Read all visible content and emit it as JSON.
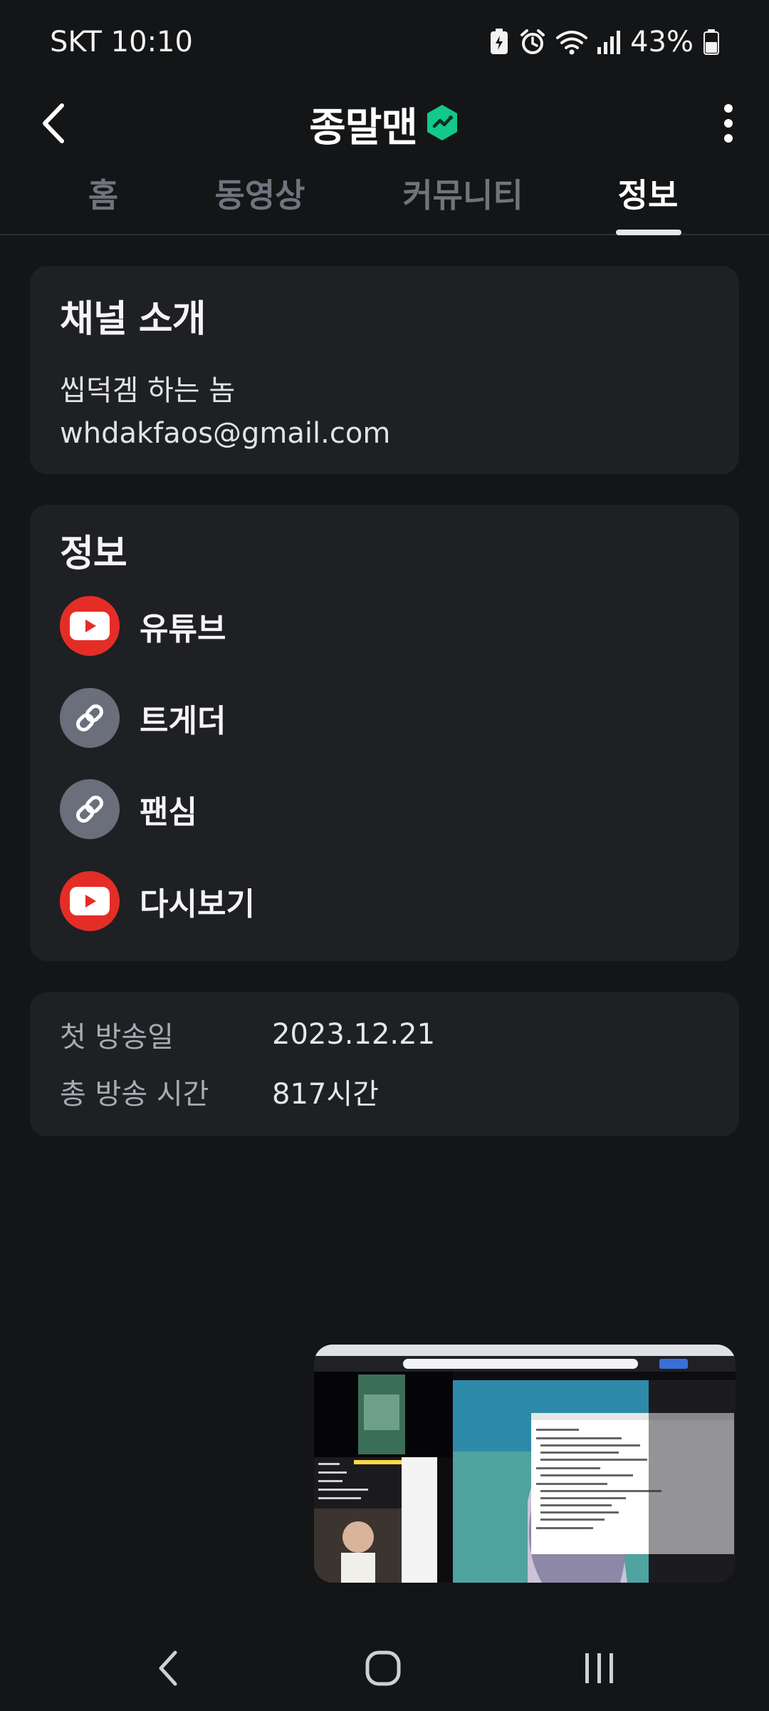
{
  "status_bar": {
    "time": "SKT 10:10",
    "battery": "43%"
  },
  "header": {
    "channel_name": "종말맨"
  },
  "tabs": [
    {
      "label": "홈",
      "active": false
    },
    {
      "label": "동영상",
      "active": false
    },
    {
      "label": "커뮤니티",
      "active": false
    },
    {
      "label": "정보",
      "active": true
    }
  ],
  "intro": {
    "title": "채널 소개",
    "lines": [
      "씹덕겜 하는 놈",
      "whdakfaos@gmail.com"
    ]
  },
  "info": {
    "title": "정보",
    "links": [
      {
        "label": "유튜브",
        "icon": "youtube-icon"
      },
      {
        "label": "트게더",
        "icon": "link-icon"
      },
      {
        "label": "팬심",
        "icon": "link-icon"
      },
      {
        "label": "다시보기",
        "icon": "youtube-icon"
      }
    ]
  },
  "stats": [
    {
      "label": "첫 방송일",
      "value": "2023.12.21"
    },
    {
      "label": "총 방송 시간",
      "value": "817시간"
    }
  ],
  "colors": {
    "background": "#141517",
    "card": "#1f2023",
    "youtube_red": "#e52d27",
    "link_gray": "#6b6f7b",
    "verified_green": "#12c98a"
  }
}
